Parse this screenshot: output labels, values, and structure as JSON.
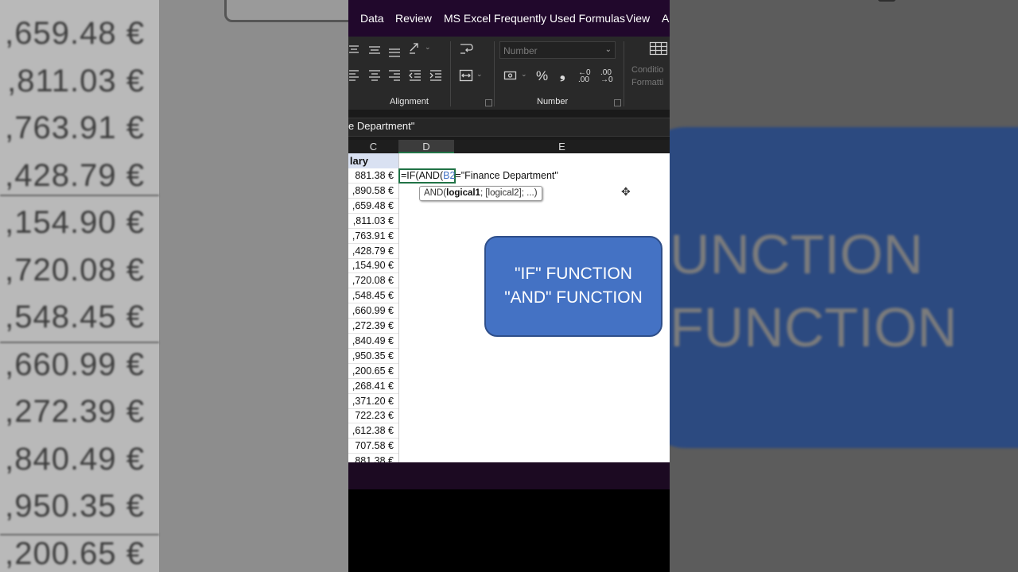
{
  "side_left": {
    "values": [
      ",659.48 €",
      ",811.03 €",
      ",763.91 €",
      ",428.79 €",
      ",154.90 €",
      ",720.08 €",
      ",548.45 €",
      ",660.99 €",
      ",272.39 €",
      ",840.49 €",
      ",950.35 €",
      ",200.65 €"
    ]
  },
  "side_right": {
    "line1": "UNCTION",
    "line2": "FUNCTION"
  },
  "menu": {
    "items": [
      "Data",
      "Review",
      "MS Excel Frequently Used Formulas",
      "View",
      "A"
    ]
  },
  "ribbon": {
    "alignment_label": "Alignment",
    "number_label": "Number",
    "number_format_placeholder": "Number",
    "conditional_formatting_label": "Conditio\nFormatti",
    "icons": [
      "align-top-icon",
      "align-middle-icon",
      "align-bottom-icon",
      "orientation-icon",
      "wrap-text-icon",
      "align-left-icon",
      "align-center-icon",
      "align-right-icon",
      "decrease-indent-icon",
      "increase-indent-icon",
      "merge-center-icon",
      "accounting-format-icon",
      "percent-icon",
      "comma-style-icon",
      "increase-decimal-icon",
      "decrease-decimal-icon",
      "conditional-formatting-icon"
    ]
  },
  "formula_bar": {
    "text": "e Department\""
  },
  "columns": [
    "C",
    "D",
    "E"
  ],
  "sheet": {
    "header_c": "lary",
    "salaries": [
      "881.38 €",
      ",890.58 €",
      ",659.48 €",
      ",811.03 €",
      ",763.91 €",
      ",428.79 €",
      ",154.90 €",
      ",720.08 €",
      ",548.45 €",
      ",660.99 €",
      ",272.39 €",
      ",840.49 €",
      ",950.35 €",
      ",200.65 €",
      ",268.41 €",
      ",371.20 €",
      "722.23 €",
      ",612.38 €",
      "707.58 €",
      "881.38 €"
    ],
    "edit_prefix": "=IF(AND(",
    "edit_ref": "B2",
    "edit_suffix": "=\"Finance Department\"",
    "tooltip_func": "AND(",
    "tooltip_bold": "logical1",
    "tooltip_rest": "; [logical2]; ...)"
  },
  "callout": {
    "line1": "\"IF\" FUNCTION",
    "line2": "\"AND\" FUNCTION"
  },
  "colors": {
    "menubar": "#21082c",
    "accent_green": "#217346",
    "callout_blue": "#4472c4",
    "header_fill": "#d9e1f2"
  }
}
